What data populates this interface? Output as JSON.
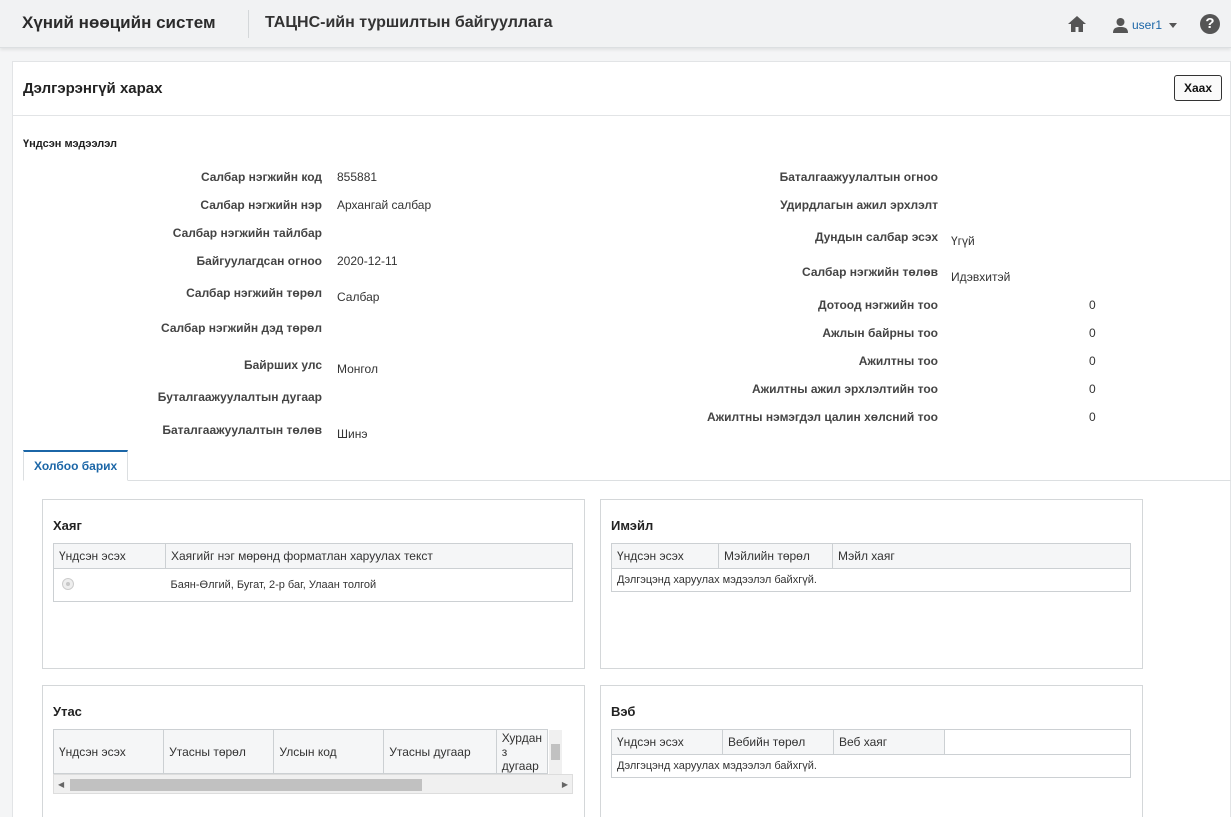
{
  "header": {
    "app_title": "Хүний нөөцийн систем",
    "org_title": "ТАЦНС-ийн туршилтын байгууллага",
    "user_name": "user1",
    "help_label": "?"
  },
  "panel": {
    "title": "Дэлгэрэнгүй харах",
    "close_label": "Хаах",
    "section_label": "Үндсэн мэдээлэл"
  },
  "left_fields": [
    {
      "label": "Салбар нэгжийн код",
      "value": "855881"
    },
    {
      "label": "Салбар нэгжийн нэр",
      "value": "Архангай салбар"
    },
    {
      "label": "Салбар нэгжийн тайлбар",
      "value": ""
    },
    {
      "label": "Байгуулагдсан огноо",
      "value": "2020-12-11"
    },
    {
      "label": "Салбар нэгжийн төрөл",
      "value": "Салбар"
    },
    {
      "label": "Салбар нэгжийн дэд төрөл",
      "value": ""
    },
    {
      "label": "Байрших улс",
      "value": "Монгол"
    },
    {
      "label": "Буталгаажуулалтын дугаар",
      "value": ""
    },
    {
      "label": "Баталгаажуулалтын төлөв",
      "value": "Шинэ"
    }
  ],
  "right_fields": [
    {
      "label": "Баталгаажуулалтын огноо",
      "value": ""
    },
    {
      "label": "Удирдлагын ажил эрхлэлт",
      "value": ""
    },
    {
      "label": "Дундын салбар эсэх",
      "value": "Үгүй"
    },
    {
      "label": "Салбар нэгжийн төлөв",
      "value": "Идэвхитэй"
    },
    {
      "label": "Дотоод нэгжийн тоо",
      "value": "0"
    },
    {
      "label": "Ажлын байрны тоо",
      "value": "0"
    },
    {
      "label": "Ажилтны тоо",
      "value": "0"
    },
    {
      "label": "Ажилтны ажил эрхлэлтийн тоо",
      "value": "0"
    },
    {
      "label": "Ажилтны нэмэгдэл цалин хөлсний тоо",
      "value": "0"
    }
  ],
  "tabs": [
    {
      "label": "Холбоо барих"
    }
  ],
  "address_card": {
    "title": "Хаяг",
    "columns": [
      "Үндсэн эсэх",
      "Хаягийг нэг мөрөнд форматлан харуулах текст"
    ],
    "rows": [
      {
        "primary": "",
        "text": "Баян-Өлгий, Бугат, 2-р баг, Улаан толгой"
      }
    ]
  },
  "email_card": {
    "title": "Имэйл",
    "columns": [
      "Үндсэн эсэх",
      "Мэйлийн төрөл",
      "Мэйл хаяг"
    ],
    "empty_text": "Дэлгэцэнд харуулах мэдээлэл байхгүй."
  },
  "phone_card": {
    "title": "Утас",
    "columns": [
      "Үндсэн эсэх",
      "Утасны төрөл",
      "Улсын код",
      "Утасны дугаар",
      "Хурдан з дугаар"
    ]
  },
  "web_card": {
    "title": "Вэб",
    "columns": [
      "Үндсэн эсэх",
      "Вебийн төрөл",
      "Веб хаяг"
    ],
    "empty_text": "Дэлгэцэнд харуулах мэдээлэл байхгүй."
  },
  "colors": {
    "accent": "#1b66a7",
    "header_bg": "#f1f2f3"
  }
}
